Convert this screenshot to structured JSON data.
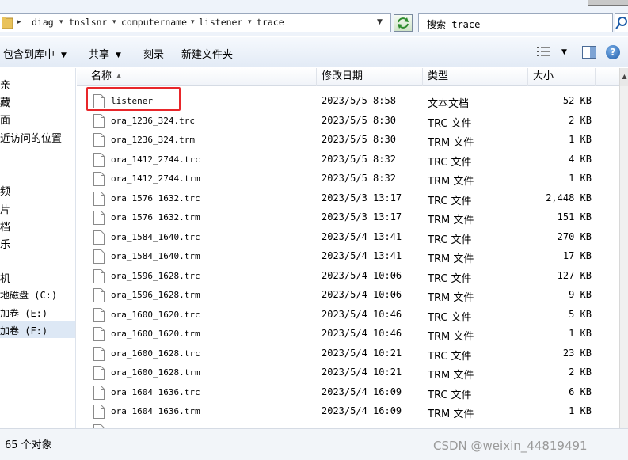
{
  "address": {
    "breadcrumbs": [
      "diag",
      "tnslsnr",
      "computername",
      "listener",
      "trace"
    ]
  },
  "search": {
    "value": "搜索 trace"
  },
  "toolbar": {
    "include_library": "包含到库中",
    "share": "共享",
    "burn": "刻录",
    "new_folder": "新建文件夹"
  },
  "nav": {
    "items": [
      "亲",
      "藏",
      "面",
      "近访问的位置",
      "",
      "",
      "频",
      "片",
      "档",
      "乐",
      "",
      "机",
      "地磁盘 (C:)",
      "加卷 (E:)",
      "加卷 (F:)"
    ]
  },
  "columns": {
    "name": "名称",
    "date": "修改日期",
    "type": "类型",
    "size": "大小"
  },
  "files": [
    {
      "name": "listener",
      "date": "2023/5/5 8:58",
      "type": "文本文档",
      "size": "52 KB"
    },
    {
      "name": "ora_1236_324.trc",
      "date": "2023/5/5 8:30",
      "type": "TRC 文件",
      "size": "2 KB"
    },
    {
      "name": "ora_1236_324.trm",
      "date": "2023/5/5 8:30",
      "type": "TRM 文件",
      "size": "1 KB"
    },
    {
      "name": "ora_1412_2744.trc",
      "date": "2023/5/5 8:32",
      "type": "TRC 文件",
      "size": "4 KB"
    },
    {
      "name": "ora_1412_2744.trm",
      "date": "2023/5/5 8:32",
      "type": "TRM 文件",
      "size": "1 KB"
    },
    {
      "name": "ora_1576_1632.trc",
      "date": "2023/5/3 13:17",
      "type": "TRC 文件",
      "size": "2,448 KB"
    },
    {
      "name": "ora_1576_1632.trm",
      "date": "2023/5/3 13:17",
      "type": "TRM 文件",
      "size": "151 KB"
    },
    {
      "name": "ora_1584_1640.trc",
      "date": "2023/5/4 13:41",
      "type": "TRC 文件",
      "size": "270 KB"
    },
    {
      "name": "ora_1584_1640.trm",
      "date": "2023/5/4 13:41",
      "type": "TRM 文件",
      "size": "17 KB"
    },
    {
      "name": "ora_1596_1628.trc",
      "date": "2023/5/4 10:06",
      "type": "TRC 文件",
      "size": "127 KB"
    },
    {
      "name": "ora_1596_1628.trm",
      "date": "2023/5/4 10:06",
      "type": "TRM 文件",
      "size": "9 KB"
    },
    {
      "name": "ora_1600_1620.trc",
      "date": "2023/5/4 10:46",
      "type": "TRC 文件",
      "size": "5 KB"
    },
    {
      "name": "ora_1600_1620.trm",
      "date": "2023/5/4 10:46",
      "type": "TRM 文件",
      "size": "1 KB"
    },
    {
      "name": "ora_1600_1628.trc",
      "date": "2023/5/4 10:21",
      "type": "TRC 文件",
      "size": "23 KB"
    },
    {
      "name": "ora_1600_1628.trm",
      "date": "2023/5/4 10:21",
      "type": "TRM 文件",
      "size": "2 KB"
    },
    {
      "name": "ora_1604_1636.trc",
      "date": "2023/5/4 16:09",
      "type": "TRC 文件",
      "size": "6 KB"
    },
    {
      "name": "ora_1604_1636.trm",
      "date": "2023/5/4 16:09",
      "type": "TRM 文件",
      "size": "1 KB"
    }
  ],
  "status": {
    "count": "65 个对象"
  },
  "watermark": "CSDN @weixin_44819491",
  "colors": {
    "highlight": "#e8262a",
    "selected_nav": "#dde8f5"
  }
}
